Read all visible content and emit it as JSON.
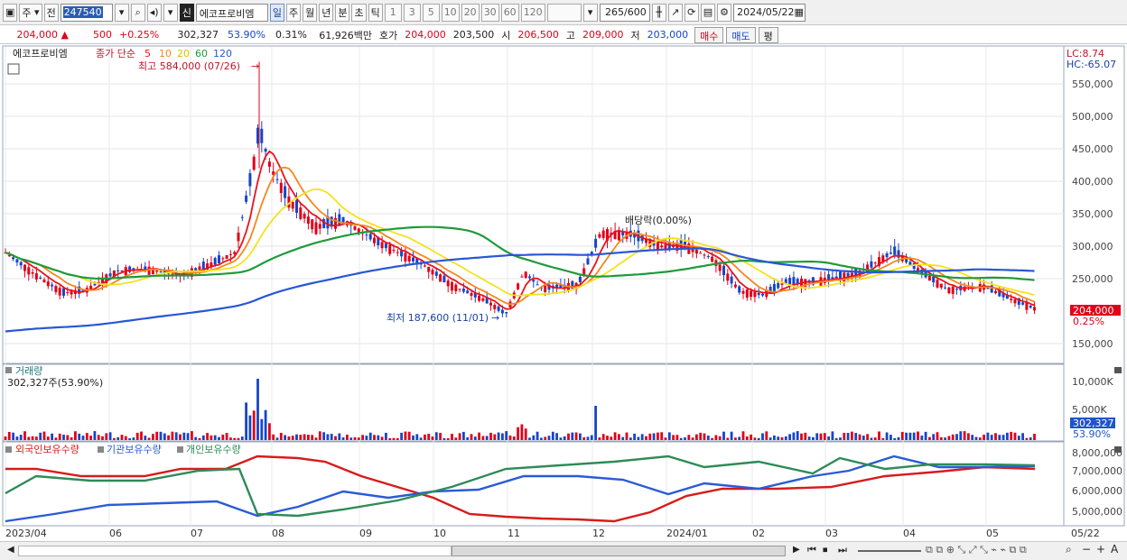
{
  "toolbar": {
    "market_label": "주",
    "prev_label": "전",
    "stock_code": "247540",
    "credit_badge": "신",
    "stock_name": "에코프로비엠",
    "periods": [
      "일",
      "주",
      "월",
      "년",
      "분",
      "초",
      "틱"
    ],
    "active_period": "일",
    "intervals": [
      "1",
      "3",
      "5",
      "10",
      "20",
      "30",
      "60",
      "120"
    ],
    "count_value": "265",
    "count_max": "/600",
    "date": "2024/05/22"
  },
  "quote": {
    "price": "204,000",
    "change": "500",
    "change_pct": "+0.25%",
    "volume": "302,327",
    "volume_ratio": "53.90%",
    "turnover_pct": "0.31%",
    "trade_value": "61,926백만",
    "bid_label": "호가",
    "bid_value": "204,000",
    "open_ref": "203,500",
    "open_label": "시",
    "open_value": "206,500",
    "high_label": "고",
    "high_value": "209,000",
    "low_label": "저",
    "low_value": "203,000",
    "buy_label": "매수",
    "sell_label": "매도",
    "eval_label": "평"
  },
  "price_panel": {
    "stock_name": "에코프로비엠",
    "ma_label": "종가 단순",
    "ma_periods": [
      "5",
      "10",
      "20",
      "60",
      "120"
    ],
    "ma_colors": [
      "#e8141c",
      "#f5871f",
      "#f5e21c",
      "#1f9a3a",
      "#2857d6"
    ],
    "high_annotation": "최고 584,000 (07/26)",
    "low_annotation": "최저 187,600 (11/01)",
    "dividend_annotation": "배당락(0.00%)",
    "lc_label": "LC:8.74",
    "hc_label": "HC:-65.07",
    "y_ticks": [
      "550,000",
      "500,000",
      "450,000",
      "400,000",
      "350,000",
      "300,000",
      "250,000",
      "150,000"
    ],
    "current_price_tag": "204,000",
    "current_pct_tag": "0.25%"
  },
  "volume_panel": {
    "title": "거래량",
    "value_text": "302,327주(53.90%)",
    "y_ticks": [
      "10,000K",
      "5,000K"
    ],
    "current_tag": "302,327",
    "current_pct": "53.90%"
  },
  "holdings_panel": {
    "series": [
      {
        "name": "외국인보유수량",
        "color": "#d81b1b"
      },
      {
        "name": "기관보유수량",
        "color": "#2a5bd7"
      },
      {
        "name": "개인보유수량",
        "color": "#2e8b57"
      }
    ],
    "y_ticks": [
      "8,000,000",
      "7,000,000",
      "6,000,000",
      "5,000,000"
    ]
  },
  "x_axis": {
    "labels": [
      "2023/04",
      "06",
      "07",
      "08",
      "09",
      "10",
      "11",
      "12",
      "2024/01",
      "02",
      "03",
      "04",
      "05",
      "05/22"
    ]
  },
  "colors": {
    "up": "#e0001a",
    "down": "#1645c8"
  }
}
